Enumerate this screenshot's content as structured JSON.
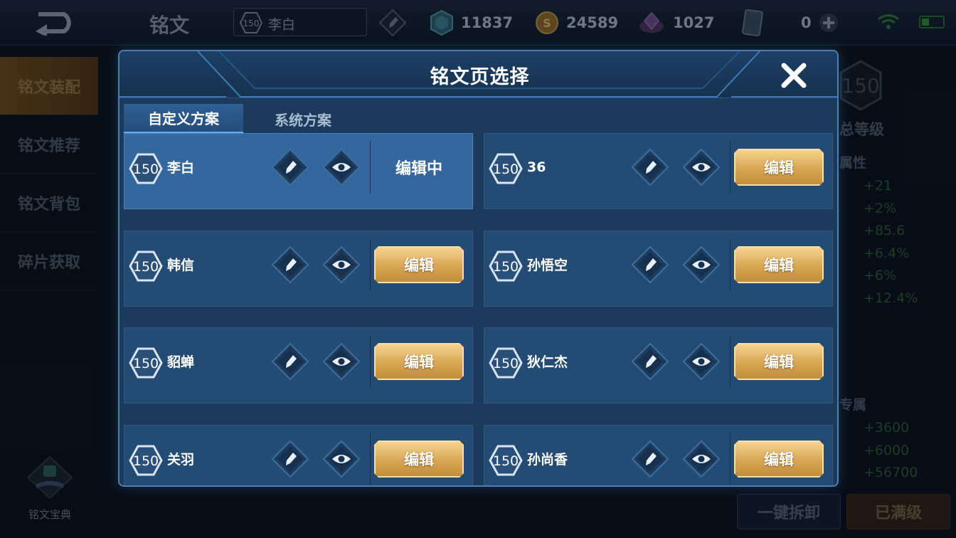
{
  "topbar": {
    "page_title": "铭文",
    "hero_level": "150",
    "hero_name": "李白",
    "currencies": [
      {
        "icon": "diamond-icon",
        "value": "11837"
      },
      {
        "icon": "gold-coin-icon",
        "value": "24589"
      },
      {
        "icon": "crystal-icon",
        "value": "1027"
      },
      {
        "icon": "card-icon",
        "value": "0"
      }
    ]
  },
  "sidebar": {
    "items": [
      {
        "label": "铭文装配"
      },
      {
        "label": "铭文推荐"
      },
      {
        "label": "铭文背包"
      },
      {
        "label": "碎片获取"
      }
    ],
    "codex_label": "铭文宝典"
  },
  "right_panel": {
    "total_level_label": "总等级",
    "total_level_value": "150",
    "attr_title": "属性",
    "attrs": [
      "+21",
      "+2%",
      "+85.6",
      "+6.4%",
      "+6%",
      "+12.4%"
    ],
    "exclusive_title": "专属",
    "exclusive_attrs": [
      "+3600",
      "+6000",
      "+56700"
    ],
    "unload_label": "一键拆卸",
    "maxed_label": "已满级"
  },
  "modal": {
    "title": "铭文页选择",
    "tabs": [
      {
        "label": "自定义方案"
      },
      {
        "label": "系统方案"
      }
    ],
    "edit_label": "编辑",
    "editing_label": "编辑中",
    "pages": [
      {
        "level": "150",
        "name": "李白",
        "editing": true
      },
      {
        "level": "150",
        "name": "36",
        "editing": false
      },
      {
        "level": "150",
        "name": "韩信",
        "editing": false
      },
      {
        "level": "150",
        "name": "孙悟空",
        "editing": false
      },
      {
        "level": "150",
        "name": "貂蝉",
        "editing": false
      },
      {
        "level": "150",
        "name": "狄仁杰",
        "editing": false
      },
      {
        "level": "150",
        "name": "关羽",
        "editing": false
      },
      {
        "level": "150",
        "name": "孙尚香",
        "editing": false
      }
    ]
  },
  "colors": {
    "accent_gold": "#d8a653",
    "modal_bg": "#1b3a5c",
    "card_bg": "#244b73",
    "card_active": "#33679e",
    "attr_green": "#2f5a33"
  }
}
